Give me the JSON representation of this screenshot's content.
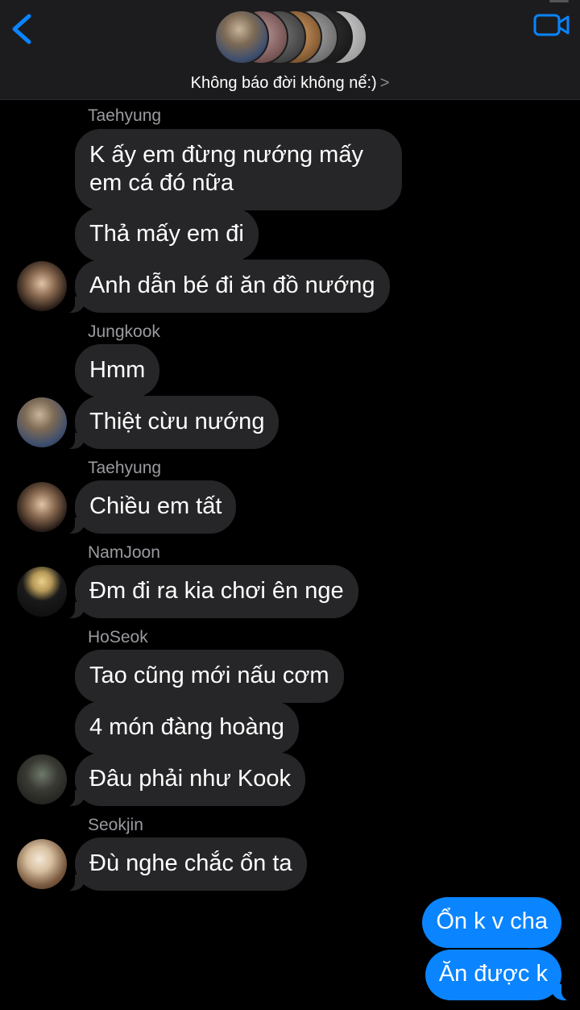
{
  "header": {
    "title": "Không báo đời không nể:)",
    "chevron": ">",
    "back_icon": "chevron-left-icon",
    "call_icon": "video-camera-icon",
    "accent": "#0a84ff"
  },
  "messages": [
    {
      "sender": "Taehyung",
      "lines": [
        "K ấy em đừng nướng mấy em cá đó nữa",
        "Thả mấy em đi",
        "Anh dẫn bé đi ăn đồ nướng"
      ]
    },
    {
      "sender": "Jungkook",
      "lines": [
        "Hmm",
        "Thiệt cừu nướng"
      ]
    },
    {
      "sender": "Taehyung",
      "lines": [
        "Chiều em tất"
      ]
    },
    {
      "sender": "NamJoon",
      "lines": [
        "Đm đi ra kia chơi ên nge"
      ]
    },
    {
      "sender": "HoSeok",
      "lines": [
        "Tao cũng mới nấu cơm",
        "4 món đàng hoàng",
        "Đâu phải như Kook"
      ]
    },
    {
      "sender": "Seokjin",
      "lines": [
        "Đù nghe chắc ổn ta"
      ]
    }
  ],
  "outgoing": [
    "Ổn k v cha",
    "Ăn được k"
  ],
  "colors": {
    "incoming_bubble": "#262628",
    "outgoing_bubble": "#0a84ff",
    "sender_name": "#9a9aa0"
  }
}
